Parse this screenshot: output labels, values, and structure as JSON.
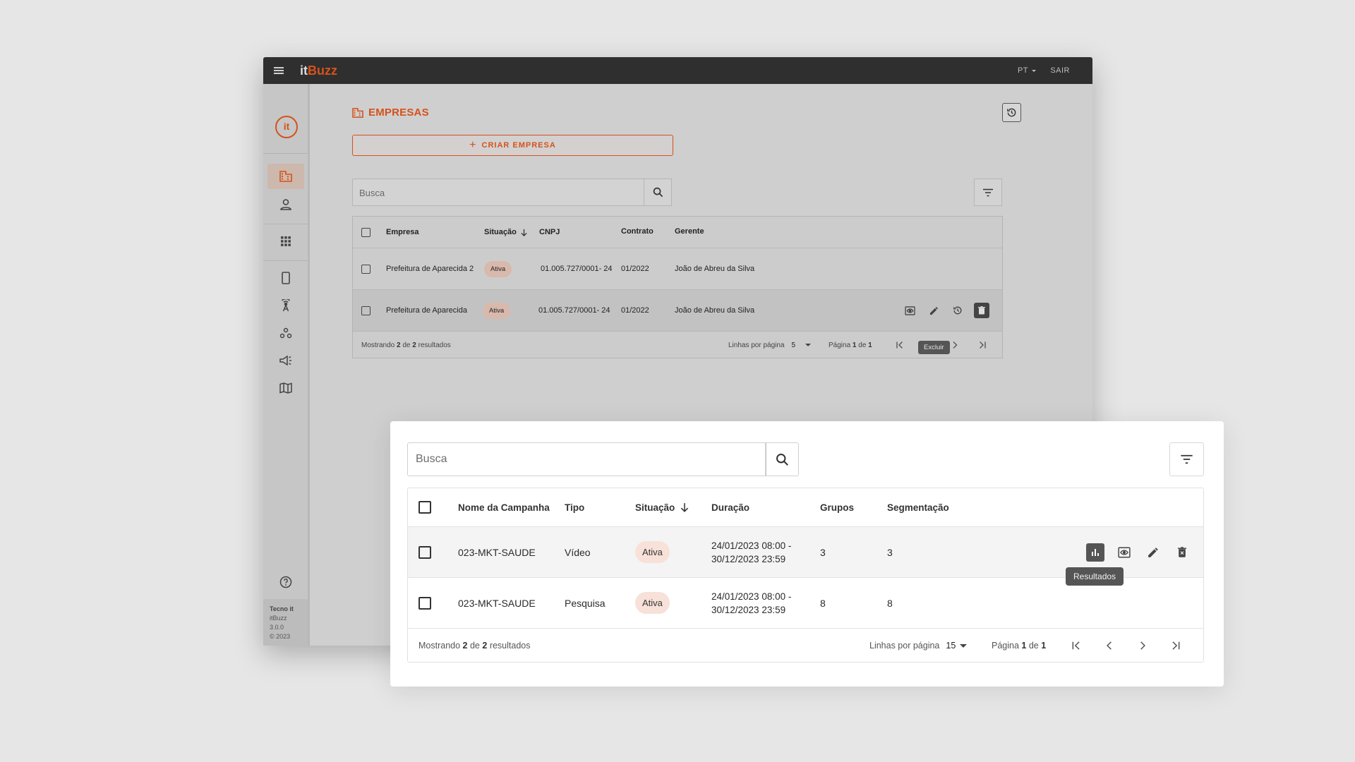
{
  "app": {
    "brand_it": "it",
    "brand_buzz": "Buzz",
    "lang": "PT",
    "logout": "SAIR",
    "logo_glyph": "it",
    "footer": {
      "company": "Tecno it",
      "product": "itBuzz",
      "version": "3.0.0",
      "copyright": "© 2023"
    },
    "sidebar_icons": [
      "building-icon",
      "person-icon",
      "apps-grid-icon",
      "smartphone-icon",
      "antenna-icon",
      "groups-icon",
      "megaphone-icon",
      "map-icon",
      "help-icon"
    ]
  },
  "companies": {
    "title": "EMPRESAS",
    "create_label": "CRIAR EMPRESA",
    "search_placeholder": "Busca",
    "columns": {
      "empresa": "Empresa",
      "situacao": "Situação",
      "cnpj": "CNPJ",
      "contrato": "Contrato",
      "gerente": "Gerente"
    },
    "rows": [
      {
        "empresa": "Prefeitura de Aparecida 2",
        "situacao": "Ativa",
        "cnpj": "01.005.727/0001- 24",
        "contrato": "01/2022",
        "gerente": "João de Abreu da Silva"
      },
      {
        "empresa": "Prefeitura de Aparecida",
        "situacao": "Ativa",
        "cnpj": "01.005.727/0001- 24",
        "contrato": "01/2022",
        "gerente": "João de Abreu da Silva"
      }
    ],
    "tooltip": "Excluir",
    "footer": {
      "showing": "Mostrando",
      "shown": "2",
      "of": "de",
      "total": "2",
      "results": "resultados",
      "rows_per_page_label": "Linhas por página",
      "rows_per_page": "5",
      "page_label": "Página",
      "page": "1",
      "page_of": "de",
      "pages": "1"
    }
  },
  "campaigns": {
    "search_placeholder": "Busca",
    "columns": {
      "nome": "Nome da Campanha",
      "tipo": "Tipo",
      "situacao": "Situação",
      "duracao": "Duração",
      "grupos": "Grupos",
      "segmentacao": "Segmentação"
    },
    "rows": [
      {
        "nome": "023-MKT-SAUDE",
        "tipo": "Vídeo",
        "situacao": "Ativa",
        "duracao_start": "24/01/2023 08:00 -",
        "duracao_end": "30/12/2023 23:59",
        "grupos": "3",
        "segmentacao": "3"
      },
      {
        "nome": "023-MKT-SAUDE",
        "tipo": "Pesquisa",
        "situacao": "Ativa",
        "duracao_start": "24/01/2023 08:00 -",
        "duracao_end": "30/12/2023 23:59",
        "grupos": "8",
        "segmentacao": "8"
      }
    ],
    "tooltip": "Resultados",
    "footer": {
      "showing": "Mostrando",
      "shown": "2",
      "of": "de",
      "total": "2",
      "results": "resultados",
      "rows_per_page_label": "Linhas por página",
      "rows_per_page": "15",
      "page_label": "Página",
      "page": "1",
      "page_of": "de",
      "pages": "1"
    }
  },
  "colors": {
    "accent": "#d4521b",
    "topbar": "#2f2f2f",
    "badge": "#f7e1d9"
  }
}
